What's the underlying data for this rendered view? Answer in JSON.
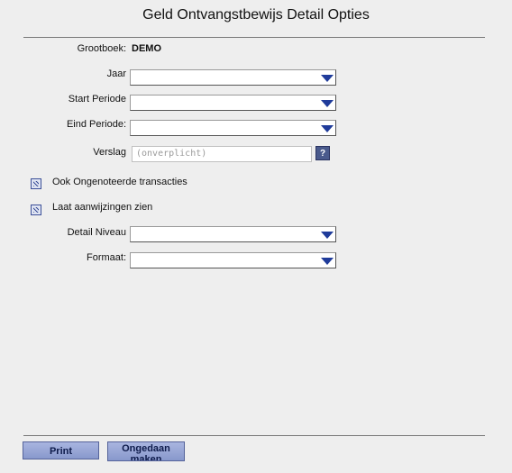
{
  "page": {
    "title": "Geld Ontvangstbewijs Detail Opties"
  },
  "grootboek": {
    "label": "Grootboek:",
    "value": "DEMO"
  },
  "fields": {
    "jaar": {
      "label": "Jaar",
      "value": ""
    },
    "start_periode": {
      "label": "Start Periode",
      "value": ""
    },
    "eind_periode": {
      "label": "Eind Periode:",
      "value": ""
    },
    "verslag": {
      "label": "Verslag",
      "placeholder": "(onverplicht)",
      "help": "?"
    },
    "detail_niveau": {
      "label": "Detail Niveau",
      "value": ""
    },
    "formaat": {
      "label": "Formaat:",
      "value": ""
    }
  },
  "checkboxes": {
    "ongenoteerde": {
      "label": "Ook Ongenoteerde transacties",
      "checked": true
    },
    "aanwijzingen": {
      "label": "Laat aanwijzingen zien",
      "checked": true
    }
  },
  "buttons": {
    "print": "Print",
    "undo": "Ongedaan maken"
  },
  "colors": {
    "accent": "#1f3b9a",
    "button": "#98a6d6",
    "background": "#eeeeee"
  }
}
